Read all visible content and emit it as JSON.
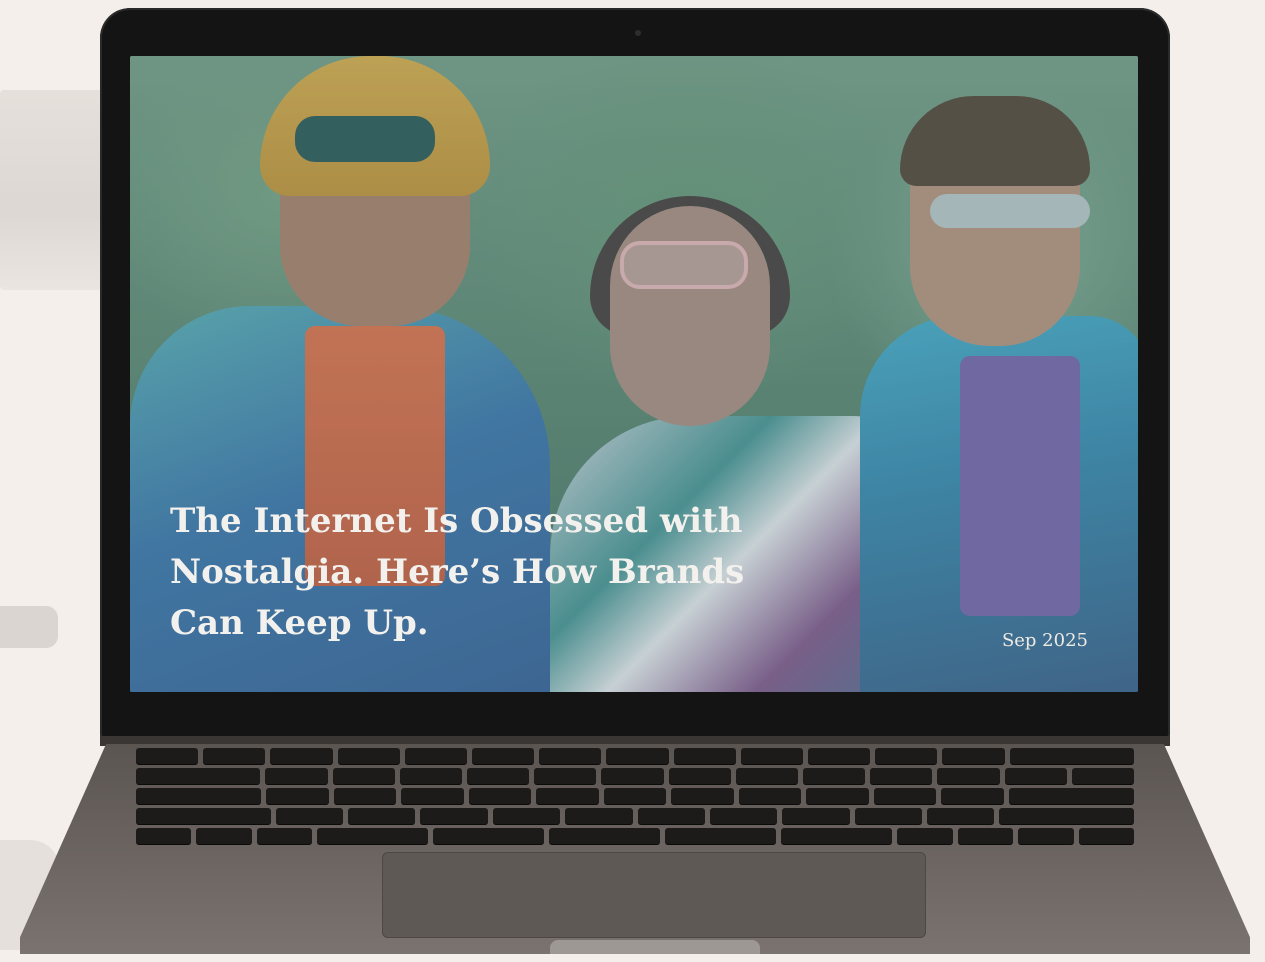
{
  "article": {
    "headline": "The Internet Is Obsessed with Nostalgia. Here’s How Brands Can Keep Up.",
    "date": "Sep 2025"
  },
  "colors": {
    "page_background": "#f4efea",
    "headline_text": "#f3f1ed"
  },
  "icons": {
    "camera": "camera-icon"
  }
}
